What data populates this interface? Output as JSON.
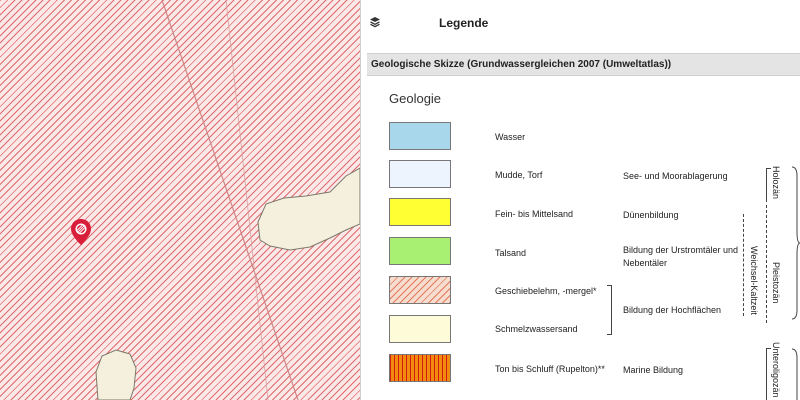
{
  "map": {
    "marker_icon": "location-pin-icon",
    "colors": {
      "hatch": "#e06a6a",
      "sand_patch": "#f5f0de"
    }
  },
  "legend_panel": {
    "header": {
      "icon": "layers-icon",
      "title": "Legende"
    },
    "layer_title": "Geologische Skizze (Grundwassergleichen 2007 (Umweltatlas))",
    "heading": "Geologie",
    "items": [
      {
        "label": "Wasser",
        "description": "",
        "color": "#a8d6ea"
      },
      {
        "label": "Mudde, Torf",
        "description": "See- und Moorablagerung",
        "color": "#eef4fd"
      },
      {
        "label": "Fein- bis Mittelsand",
        "description": "Dünenbildung",
        "color": "#ffff33"
      },
      {
        "label": "Talsand",
        "description": "Bildung der Urstromtäler und Nebentäler",
        "color": "#a8f072"
      },
      {
        "label": "Geschiebelehm, -mergel*",
        "description": "",
        "color": "#f7ddd0"
      },
      {
        "label": "Schmelzwassersand",
        "description": "",
        "color": "#fefbd8"
      },
      {
        "label": "Ton bis Schluff  (Rupelton)**",
        "description": "Marine Bildung",
        "color": "#f38a10"
      }
    ],
    "grouped_description": "Bildung der Hochflächen",
    "strat": {
      "holozaen": "Holozän",
      "weichsel": "Weichsel-Kaltzeit",
      "pleistozaen": "Pleistozän",
      "unteroligozaen": "Unteroligozän"
    }
  }
}
